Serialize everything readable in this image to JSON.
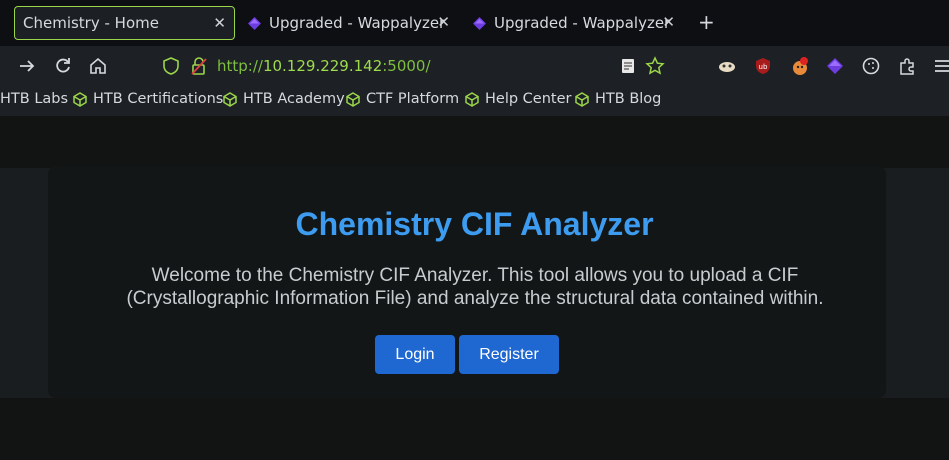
{
  "tabs": [
    {
      "label": "Chemistry - Home",
      "active": true
    },
    {
      "label": "Upgraded - Wappalyzer",
      "active": false
    },
    {
      "label": "Upgraded - Wappalyzer",
      "active": false
    }
  ],
  "tab_close_glyph": "✕",
  "new_tab_glyph": "+",
  "address": {
    "scheme": "http://",
    "host": "10.129.229.142",
    "port": ":5000/"
  },
  "bookmarks": [
    "HTB Labs",
    "HTB Certifications",
    "HTB Academy",
    "CTF Platform",
    "Help Center",
    "HTB Blog"
  ],
  "page": {
    "title": "Chemistry CIF Analyzer",
    "description_line1": "Welcome to the Chemistry CIF Analyzer. This tool allows you to upload a CIF",
    "description_line2": "(Crystallographic Information File) and analyze the structural data contained within.",
    "login_label": "Login",
    "register_label": "Register"
  },
  "colors": {
    "accent_green": "#9bd64a",
    "title_blue": "#3d9cf0",
    "button_blue": "#1f68d1",
    "wappalyzer_purple": "#6d3de0"
  },
  "icons": [
    "forward-icon",
    "reload-icon",
    "home-icon",
    "shield-icon",
    "insecure-lock-icon",
    "reader-mode-icon",
    "bookmark-star-icon",
    "extension-icons",
    "puzzle-icon",
    "menu-icon"
  ]
}
